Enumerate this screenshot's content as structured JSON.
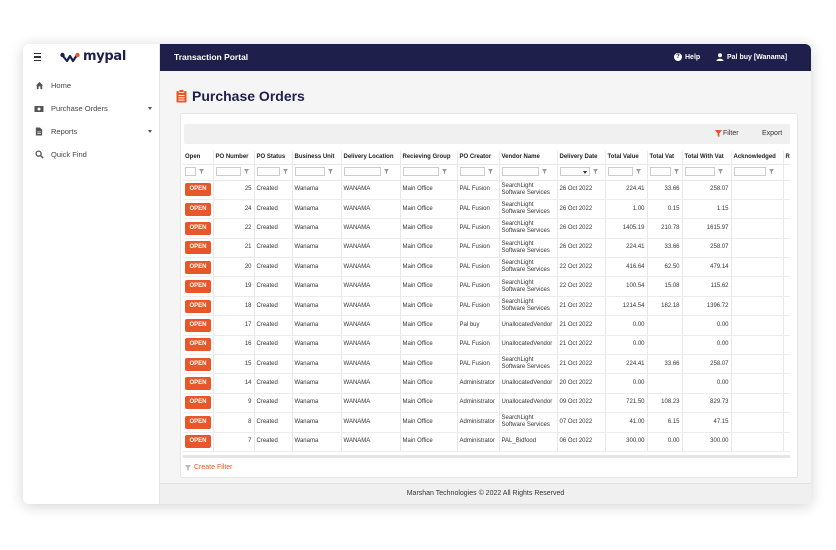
{
  "app": {
    "logo_text": "mypal",
    "brand_color": "#1e1f4a",
    "accent_color": "#e8572a"
  },
  "sidebar": {
    "items": [
      {
        "label": "Home",
        "icon": "home-icon"
      },
      {
        "label": "Purchase Orders",
        "icon": "money-icon",
        "expandable": true
      },
      {
        "label": "Reports",
        "icon": "document-icon",
        "expandable": true
      },
      {
        "label": "Quick Find",
        "icon": "search-icon"
      }
    ]
  },
  "topbar": {
    "title": "Transaction Portal",
    "help_label": "Help",
    "user_label": "Pal buy [Wanama]"
  },
  "page": {
    "title": "Purchase Orders"
  },
  "toolbar": {
    "filter_label": "Filter",
    "export_label": "Export"
  },
  "table": {
    "columns": [
      "Open",
      "PO Number",
      "PO Status",
      "Business Unit",
      "Delivery Location",
      "Recieving Group",
      "PO Creator",
      "Vendor Name",
      "Delivery Date",
      "Total Value",
      "Total Vat",
      "Total With Vat",
      "Acknowledged",
      "R"
    ],
    "open_label": "OPEN",
    "rows": [
      [
        "25",
        "Created",
        "Wanama",
        "WANAMA",
        "Main Office",
        "PAL Fusion",
        "SearchLight Software Services",
        "26 Oct 2022",
        "224.41",
        "33.66",
        "258.07"
      ],
      [
        "24",
        "Created",
        "Wanama",
        "WANAMA",
        "Main Office",
        "PAL Fusion",
        "SearchLight Software Services",
        "26 Oct 2022",
        "1.00",
        "0.15",
        "1.15"
      ],
      [
        "22",
        "Created",
        "Wanama",
        "WANAMA",
        "Main Office",
        "PAL Fusion",
        "SearchLight Software Services",
        "26 Oct 2022",
        "1405.19",
        "210.78",
        "1615.97"
      ],
      [
        "21",
        "Created",
        "Wanama",
        "WANAMA",
        "Main Office",
        "PAL Fusion",
        "SearchLight Software Services",
        "26 Oct 2022",
        "224.41",
        "33.66",
        "258.07"
      ],
      [
        "20",
        "Created",
        "Wanama",
        "WANAMA",
        "Main Office",
        "PAL Fusion",
        "SearchLight Software Services",
        "22 Oct 2022",
        "416.64",
        "62.50",
        "479.14"
      ],
      [
        "19",
        "Created",
        "Wanama",
        "WANAMA",
        "Main Office",
        "PAL Fusion",
        "SearchLight Software Services",
        "22 Oct 2022",
        "100.54",
        "15.08",
        "115.62"
      ],
      [
        "18",
        "Created",
        "Wanama",
        "WANAMA",
        "Main Office",
        "PAL Fusion",
        "SearchLight Software Services",
        "21 Oct 2022",
        "1214.54",
        "182.18",
        "1396.72"
      ],
      [
        "17",
        "Created",
        "Wanama",
        "WANAMA",
        "Main Office",
        "Pal buy",
        "UnallocatedVendor",
        "21 Oct 2022",
        "0.00",
        "",
        "0.00"
      ],
      [
        "16",
        "Created",
        "Wanama",
        "WANAMA",
        "Main Office",
        "PAL Fusion",
        "UnallocatedVendor",
        "21 Oct 2022",
        "0.00",
        "",
        "0.00"
      ],
      [
        "15",
        "Created",
        "Wanama",
        "WANAMA",
        "Main Office",
        "PAL Fusion",
        "SearchLight Software Services",
        "21 Oct 2022",
        "224.41",
        "33.66",
        "258.07"
      ],
      [
        "14",
        "Created",
        "Wanama",
        "WANAMA",
        "Main Office",
        "Administrator",
        "UnallocatedVendor",
        "20 Oct 2022",
        "0.00",
        "",
        "0.00"
      ],
      [
        "9",
        "Created",
        "Wanama",
        "WANAMA",
        "Main Office",
        "Administrator",
        "UnallocatedVendor",
        "09 Oct 2022",
        "721.50",
        "108.23",
        "829.73"
      ],
      [
        "8",
        "Created",
        "Wanama",
        "WANAMA",
        "Main Office",
        "Administrator",
        "SearchLight Software Services",
        "07 Oct 2022",
        "41.00",
        "6.15",
        "47.15"
      ],
      [
        "7",
        "Created",
        "Wanama",
        "WANAMA",
        "Main Office",
        "Administrator",
        "PAL_Bidfood",
        "06 Oct 2022",
        "300.00",
        "0.00",
        "300.00"
      ]
    ]
  },
  "create_filter_label": "Create Filter",
  "footer": {
    "text": "Marshan Technologies © 2022 All Rights Reserved"
  }
}
